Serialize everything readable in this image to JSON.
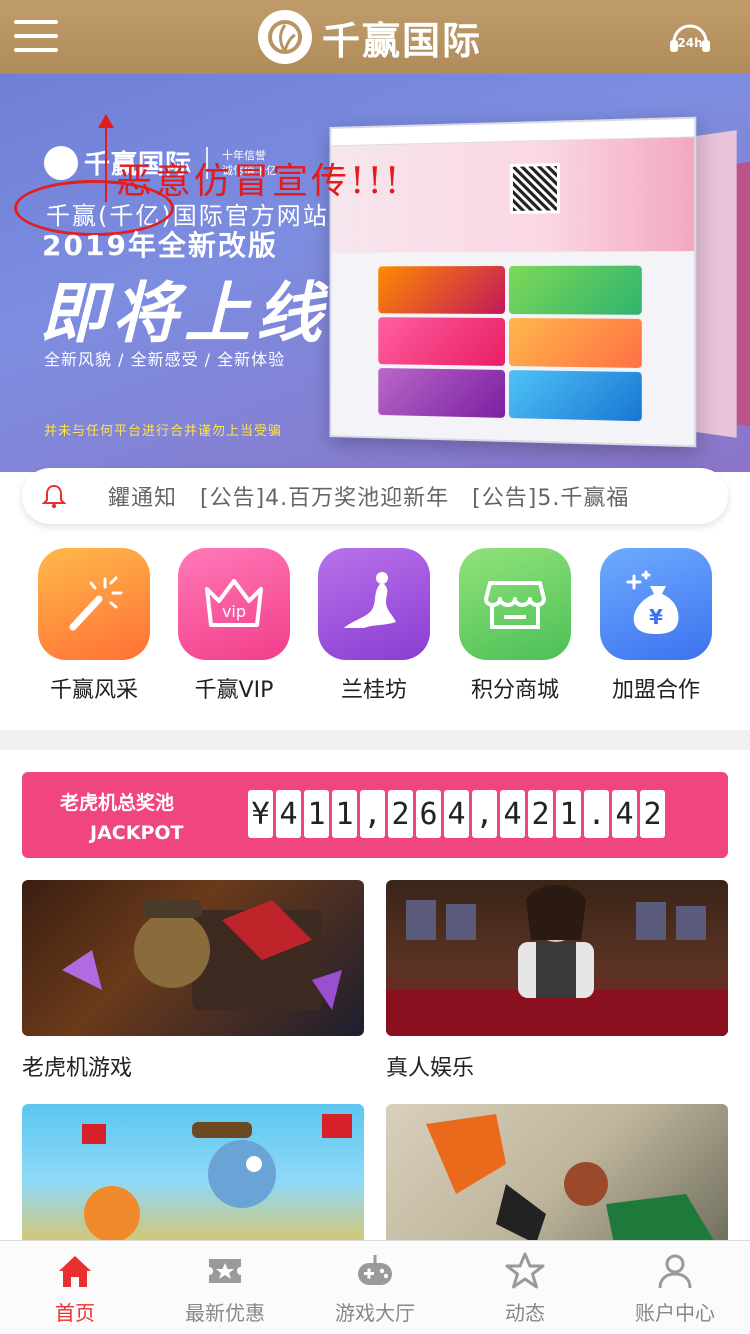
{
  "header": {
    "brand": "千赢国际",
    "menu_icon": "hamburger-menu-icon",
    "support_icon": "24h-support-icon",
    "support_text": "24h",
    "bg_color": "#b89463"
  },
  "banner": {
    "warning": "恶意仿冒宣传!!!",
    "logo_name": "千赢国际",
    "logo_sub1": "十年信誉",
    "logo_sub2": "诚信值千亿",
    "line1": "千赢(千亿)国际官方网站",
    "line2": "2019年全新改版",
    "line3": "即将上线",
    "line4": "全新风貌 / 全新感受 / 全新体验",
    "line5": "并未与任何平台进行合并谨勿上当受骗"
  },
  "notice": {
    "text": "鑺通知　[公告]4.百万奖池迎新年　[公告]5.千赢福",
    "icon": "bell-icon",
    "color": "#e8312f"
  },
  "quick_links": [
    {
      "label": "千赢风采",
      "icon": "magic-wand-icon",
      "color1": "#ffb24a",
      "color2": "#ff6f3a"
    },
    {
      "label": "千赢VIP",
      "icon": "vip-crown-icon",
      "color1": "#ff7ab8",
      "color2": "#f23d8a"
    },
    {
      "label": "兰桂坊",
      "icon": "lady-silhouette-icon",
      "color1": "#b46ee6",
      "color2": "#8b3fd2"
    },
    {
      "label": "积分商城",
      "icon": "shop-icon",
      "color1": "#8fe07a",
      "color2": "#4fc25a"
    },
    {
      "label": "加盟合作",
      "icon": "money-bag-icon",
      "color1": "#6aa7ff",
      "color2": "#3d73f0"
    }
  ],
  "jackpot": {
    "title": "老虎机总奖池",
    "subtitle": "JACKPOT",
    "amount": "¥411,264,421.42"
  },
  "games": [
    {
      "label": "老虎机游戏"
    },
    {
      "label": "真人娱乐"
    },
    {
      "label": ""
    },
    {
      "label": ""
    }
  ],
  "tabbar": [
    {
      "label": "首页",
      "icon": "home-icon",
      "active": true
    },
    {
      "label": "最新优惠",
      "icon": "ticket-star-icon",
      "active": false
    },
    {
      "label": "游戏大厅",
      "icon": "gamepad-icon",
      "active": false
    },
    {
      "label": "动态",
      "icon": "star-icon",
      "active": false
    },
    {
      "label": "账户中心",
      "icon": "user-icon",
      "active": false
    }
  ]
}
